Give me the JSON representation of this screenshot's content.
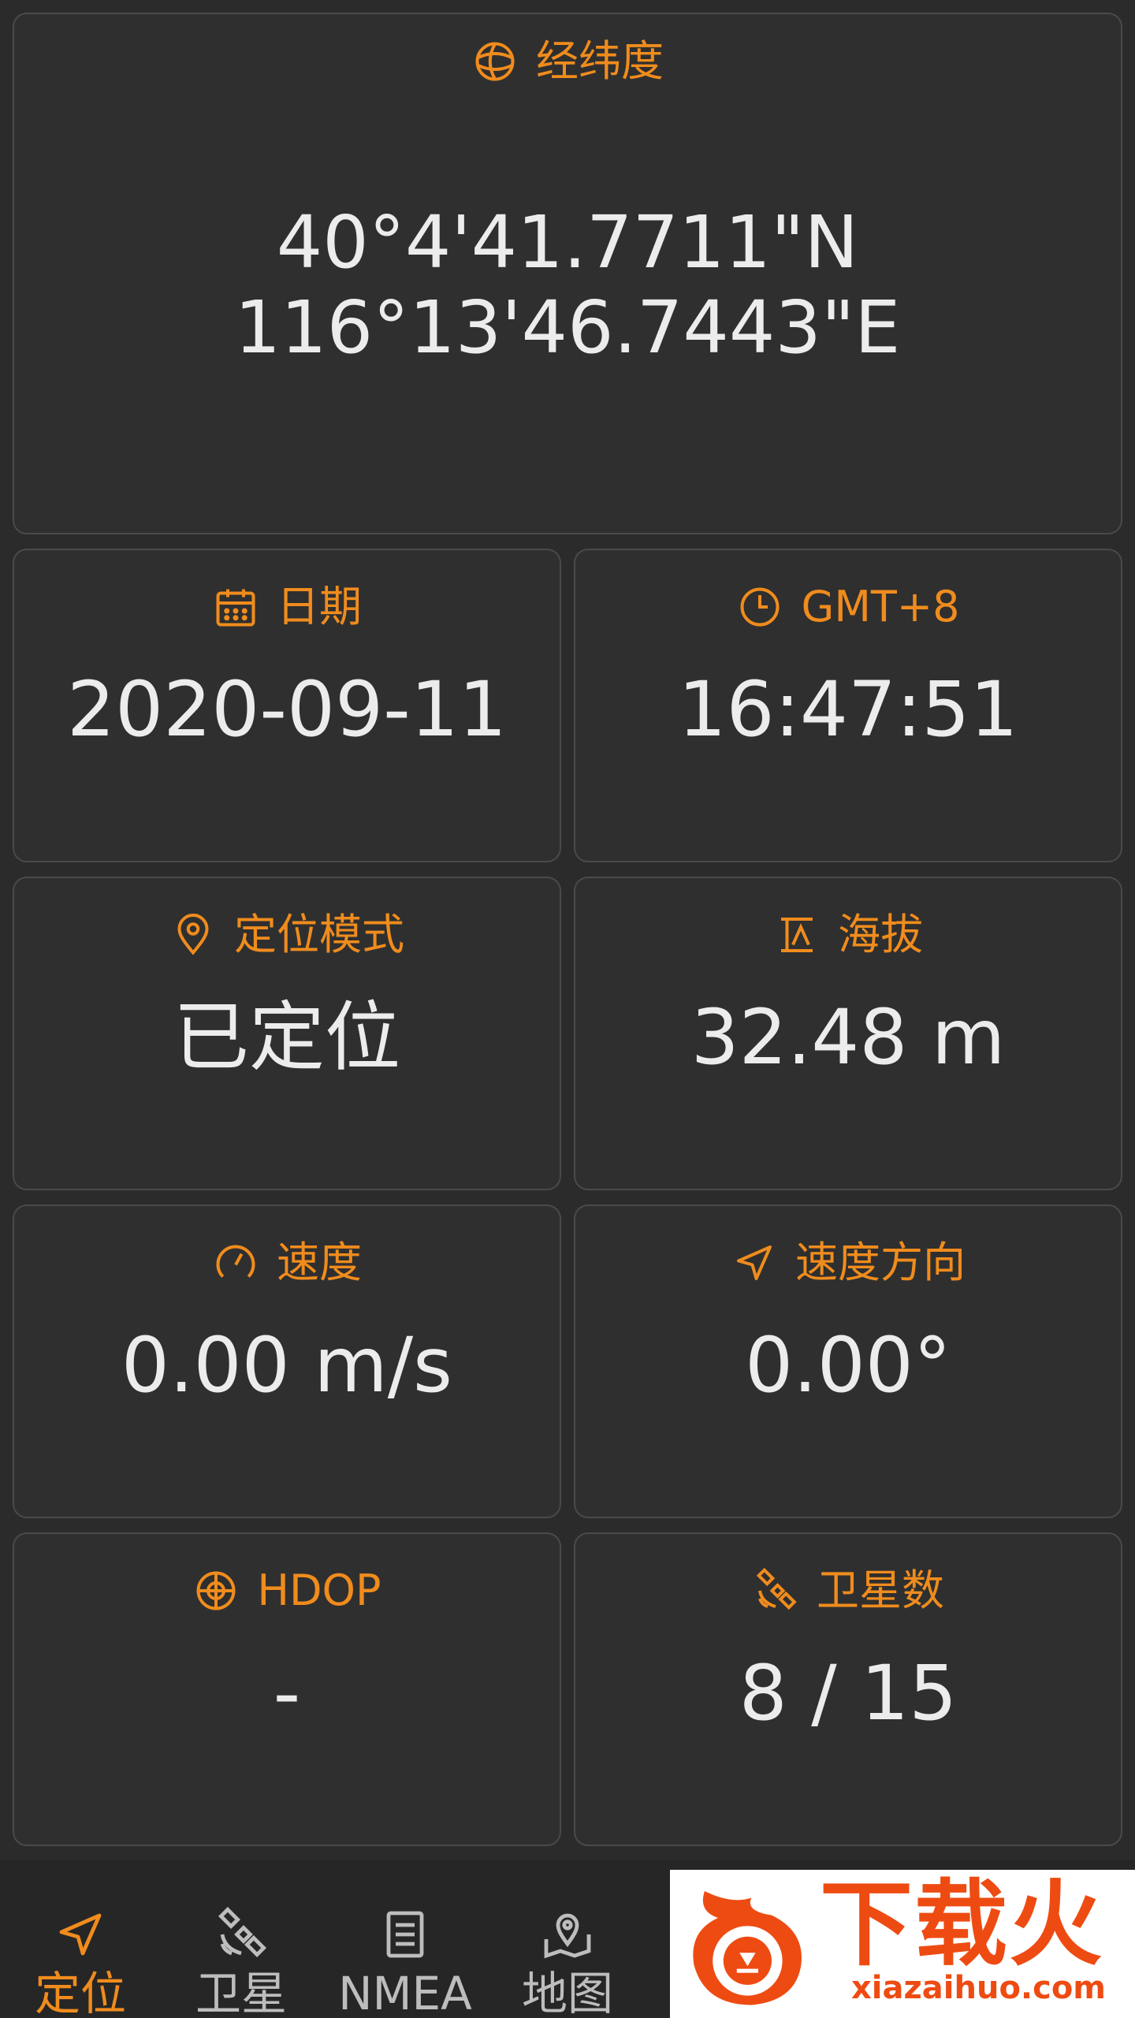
{
  "colors": {
    "accent": "#f08c1d",
    "card_bg": "#2f2f2f",
    "card_border": "#4a4a4a",
    "text": "#ececec",
    "nav_inactive": "#bdbdbd",
    "watermark": "#ee4b12"
  },
  "latlon": {
    "label": "经纬度",
    "icon": "globe-icon",
    "lat": "40°4'41.7711\"N",
    "lon": "116°13'46.7443\"E"
  },
  "date": {
    "label": "日期",
    "icon": "calendar-icon",
    "value": "2020-09-11"
  },
  "time": {
    "label": "GMT+8",
    "icon": "clock-icon",
    "value": "16:47:51"
  },
  "fix_mode": {
    "label": "定位模式",
    "icon": "location-pin-icon",
    "value": "已定位"
  },
  "altitude": {
    "label": "海拔",
    "icon": "altitude-icon",
    "value": "32.48 m"
  },
  "speed": {
    "label": "速度",
    "icon": "speedometer-icon",
    "value": "0.00 m/s"
  },
  "bearing": {
    "label": "速度方向",
    "icon": "navigation-arrow-icon",
    "value": "0.00°"
  },
  "hdop": {
    "label": "HDOP",
    "icon": "crosshair-icon",
    "value": "-"
  },
  "satellites": {
    "label": "卫星数",
    "icon": "satellite-icon",
    "value": "8 / 15"
  },
  "nav": {
    "items": [
      {
        "label": "定位",
        "icon": "navigation-arrow-icon",
        "active": true
      },
      {
        "label": "卫星",
        "icon": "satellite-icon",
        "active": false
      },
      {
        "label": "NMEA",
        "icon": "document-icon",
        "active": false
      },
      {
        "label": "地图",
        "icon": "map-icon",
        "active": false
      }
    ]
  },
  "watermark": {
    "brand": "下载火",
    "domain": "xiazaihuo.com"
  }
}
